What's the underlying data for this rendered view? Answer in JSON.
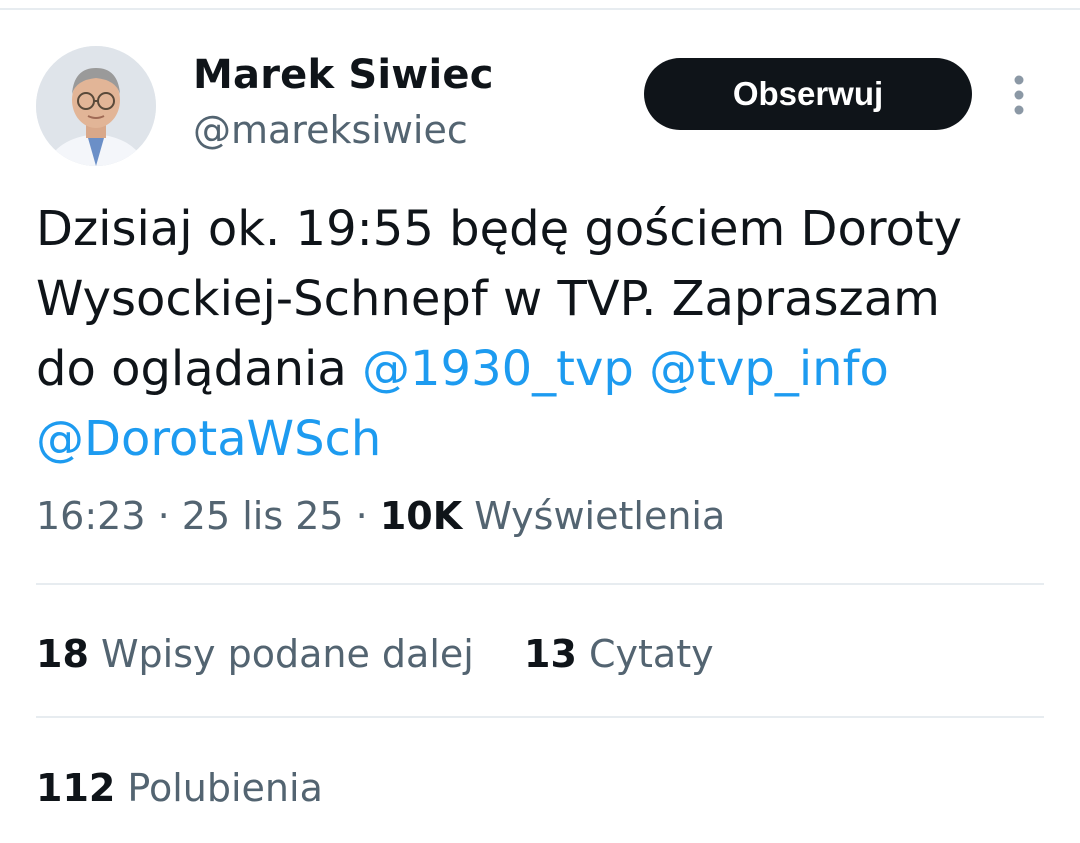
{
  "user": {
    "display_name": "Marek Siwiec",
    "handle": "@mareksiwiec"
  },
  "follow_button": {
    "label": "Obserwuj",
    "background": "#0f1419",
    "text_color": "#ffffff"
  },
  "tweet": {
    "text_lines": [
      "Dzisiaj ok. 19:55 będę gościem Doroty",
      "Wysockiej-Schnepf w TVP. Zapraszam",
      "do oglądania"
    ],
    "mentions": [
      "@1930_tvp",
      "@tvp_info",
      "@DorotaWSch"
    ],
    "mention_color": "#1d9bf0"
  },
  "meta": {
    "time": "16:23",
    "separator": "·",
    "date": "25 lis 25",
    "views_count": "10K",
    "views_label": "Wyświetlenia"
  },
  "stats": {
    "reposts_count": "18",
    "reposts_label": "Wpisy podane dalej",
    "quotes_count": "13",
    "quotes_label": "Cytaty",
    "likes_count": "112",
    "likes_label": "Polubienia"
  },
  "icons": {
    "more": "more-vertical-icon"
  }
}
